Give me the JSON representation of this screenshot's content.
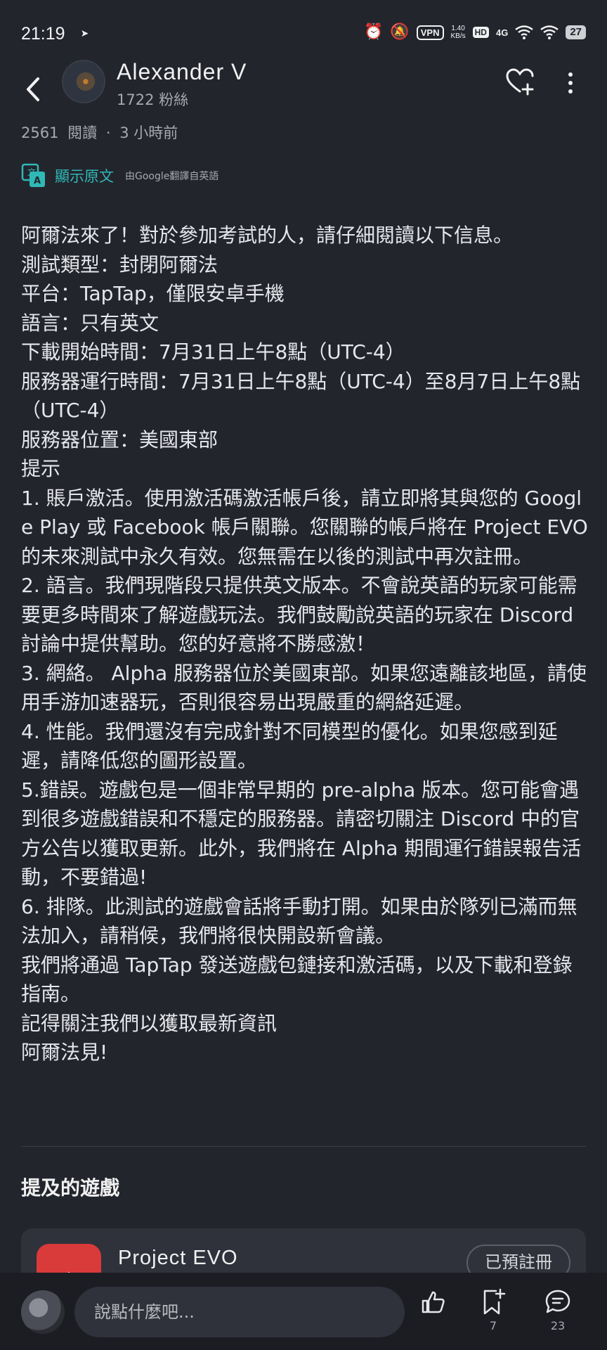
{
  "status_bar": {
    "time": "21:19",
    "vpn": "VPN",
    "speed_value": "1.40",
    "speed_unit": "KB/s",
    "hd": "HD",
    "network": "4G",
    "battery": "27"
  },
  "header": {
    "username": "Alexander  V",
    "followers": "1722  粉絲"
  },
  "meta": {
    "reads": "2561",
    "reads_label": "閱讀",
    "separator": "·",
    "time_ago": "3  小時前"
  },
  "translate": {
    "show_original": "顯示原文",
    "note": "由Google翻譯自英語"
  },
  "post_lines": [
    "阿爾法來了！對於參加考試的人，請仔細閱讀以下信息。",
    "測試類型：封閉阿爾法",
    "平台：TapTap，僅限安卓手機",
    "語言：只有英文",
    "下載開始時間：7月31日上午8點（UTC-4）",
    "服務器運行時間：7月31日上午8點（UTC-4）至8月7日上午8點（UTC-4）",
    "服務器位置：美國東部",
    "提示",
    "1. 賬戶激活。使用激活碼激活帳戶後，請立即將其與您的 Google Play 或 Facebook 帳戶關聯。您關聯的帳戶將在 Project EVO 的未來測試中永久有效。您無需在以後的測試中再次註冊。",
    "2. 語言。我們現階段只提供英文版本。不會說英語的玩家可能需要更多時間來了解遊戲玩法。我們鼓勵說英語的玩家在 Discord 討論中提供幫助。您的好意將不勝感激！",
    "3. 網絡。 Alpha 服務器位於美國東部。如果您遠離該地區，請使用手游加速器玩，否則很容易出現嚴重的網絡延遲。",
    "4. 性能。我們還沒有完成針對不同模型的優化。如果您感到延遲，請降低您的圖形設置。",
    "5.錯誤。遊戲包是一個非常早期的 pre-alpha 版本。您可能會遇到很多遊戲錯誤和不穩定的服務器。請密切關注 Discord 中的官方公告以獲取更新。此外，我們將在 Alpha 期間運行錯誤報告活動，不要錯過!",
    "6. 排隊。此測試的遊戲會話將手動打開。如果由於隊列已滿而無法加入，請稍候，我們將很快開設新會議。",
    "我們將通過 TapTap 發送遊戲包鏈接和激活碼，以及下載和登錄指南。",
    "記得關注我們以獲取最新資訊",
    "阿爾法見!"
  ],
  "mentioned": {
    "title": "提及的遊戲",
    "game_name": "Project  EVO",
    "button": "已預註冊"
  },
  "bottom_bar": {
    "comment_placeholder": "說點什麼吧...",
    "bookmark_count": "7",
    "comment_count": "23"
  }
}
